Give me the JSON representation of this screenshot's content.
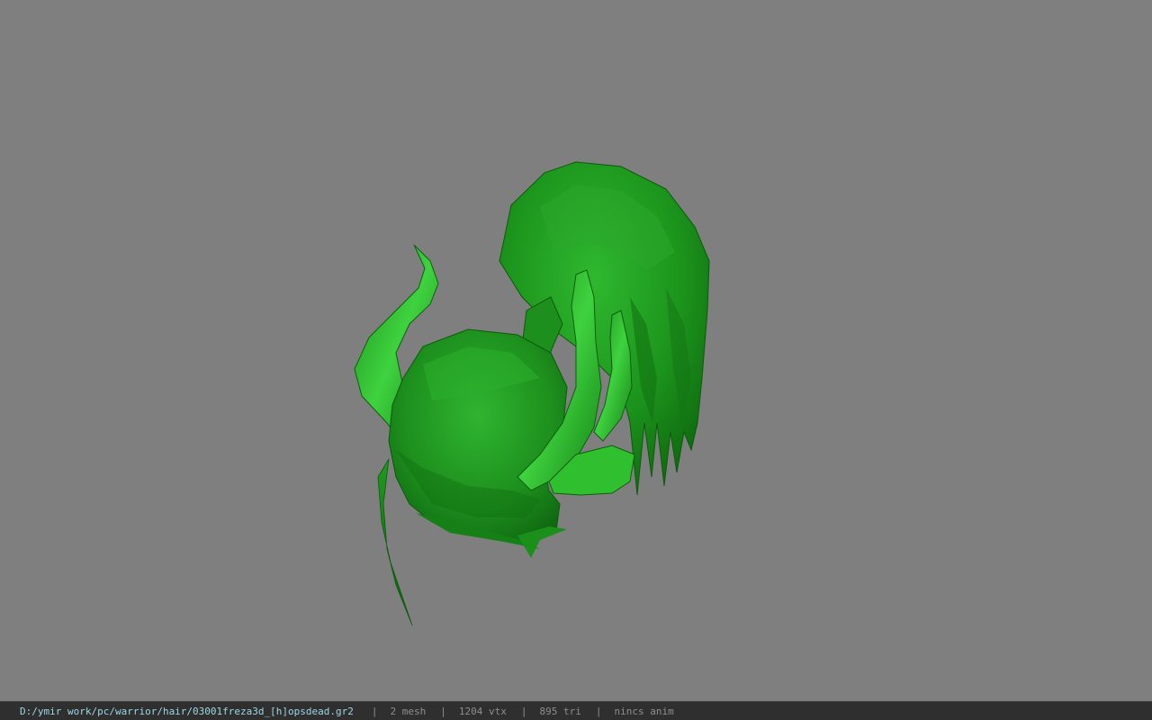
{
  "viewer": {
    "model_name": "03001freza3d_[h]opsdead.gr2",
    "background_color": "#7f7f7f",
    "model_color": "#1ea01e"
  },
  "statusbar": {
    "path": "D:/ymir work/pc/warrior/hair/03001freza3d_[h]opsdead.gr2",
    "separator": "|",
    "mesh": "2 mesh",
    "vtx": "1204 vtx",
    "tri": "895 tri",
    "anim": "nincs anim"
  }
}
